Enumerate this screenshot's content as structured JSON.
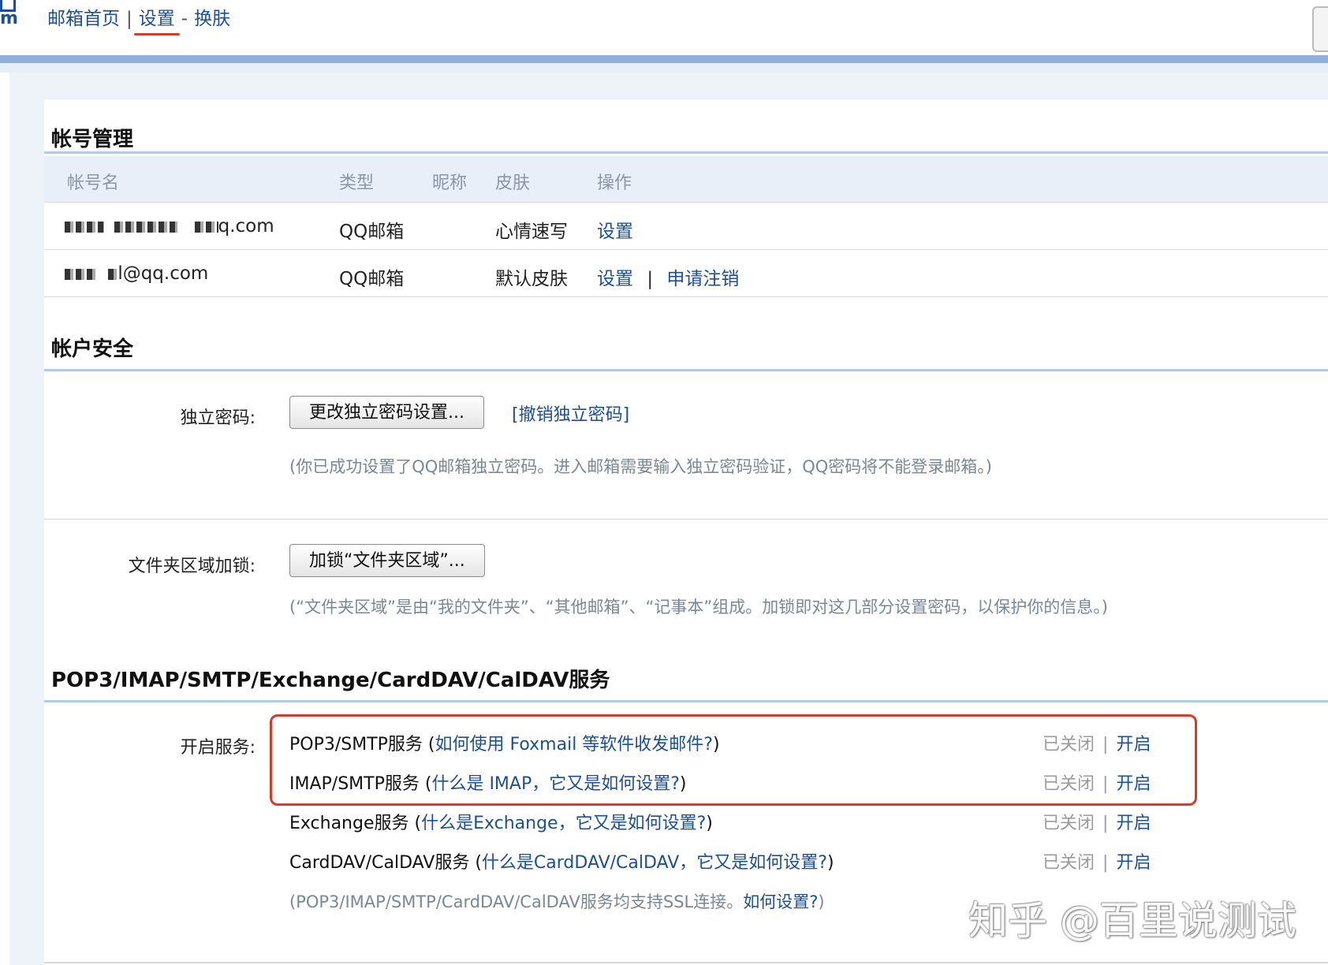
{
  "topnav": {
    "logo_fragment": "m",
    "home": "邮箱首页",
    "sep": "|",
    "settings": "设置",
    "dash": "-",
    "skin": "换肤"
  },
  "accounts": {
    "title": "帐号管理",
    "headers": {
      "name": "帐号名",
      "type": "类型",
      "nickname": "昵称",
      "skin": "皮肤",
      "actions": "操作"
    },
    "rows": [
      {
        "name_visible": "q.com",
        "type": "QQ邮箱",
        "skin": "心情速写",
        "action1": "设置",
        "action_sep": "",
        "action2": ""
      },
      {
        "name_visible": "l@qq.com",
        "type": "QQ邮箱",
        "skin": "默认皮肤",
        "action1": "设置",
        "action_sep": "|",
        "action2": "申请注销"
      }
    ]
  },
  "security": {
    "title": "帐户安全",
    "password": {
      "label": "独立密码:",
      "button": "更改独立密码设置...",
      "link": "[撤销独立密码]",
      "note": "(你已成功设置了QQ邮箱独立密码。进入邮箱需要输入独立密码验证，QQ密码将不能登录邮箱。)"
    },
    "folder": {
      "label": "文件夹区域加锁:",
      "button": "加锁“文件夹区域”...",
      "note": "(“文件夹区域”是由“我的文件夹”、“其他邮箱”、“记事本”组成。加锁即对这几部分设置密码，以保护你的信息。)"
    }
  },
  "services": {
    "title": "POP3/IMAP/SMTP/Exchange/CardDAV/CalDAV服务",
    "label": "开启服务:",
    "items": [
      {
        "name": "POP3/SMTP服务",
        "open_paren": "(",
        "help": "如何使用 Foxmail 等软件收发邮件?",
        "close_paren": ")",
        "status": "已关闭",
        "sep": "|",
        "action": "开启"
      },
      {
        "name": "IMAP/SMTP服务",
        "open_paren": "(",
        "help": "什么是 IMAP，它又是如何设置?",
        "close_paren": ")",
        "status": "已关闭",
        "sep": "|",
        "action": "开启"
      },
      {
        "name": "Exchange服务",
        "open_paren": "(",
        "help": "什么是Exchange，它又是如何设置?",
        "close_paren": ")",
        "status": "已关闭",
        "sep": "|",
        "action": "开启"
      },
      {
        "name": "CardDAV/CalDAV服务",
        "open_paren": "(",
        "help": "什么是CardDAV/CalDAV，它又是如何设置?",
        "close_paren": ")",
        "status": "已关闭",
        "sep": "|",
        "action": "开启"
      }
    ],
    "ssl_note": "(POP3/IMAP/SMTP/CardDAV/CalDAV服务均支持SSL连接。",
    "ssl_link": "如何设置?",
    "ssl_close": ")"
  },
  "watermark": "知乎 @百里说测试",
  "colors": {
    "accent": "#1c4f94",
    "highlight": "#d93a2b",
    "band": "#8fb0dc"
  }
}
